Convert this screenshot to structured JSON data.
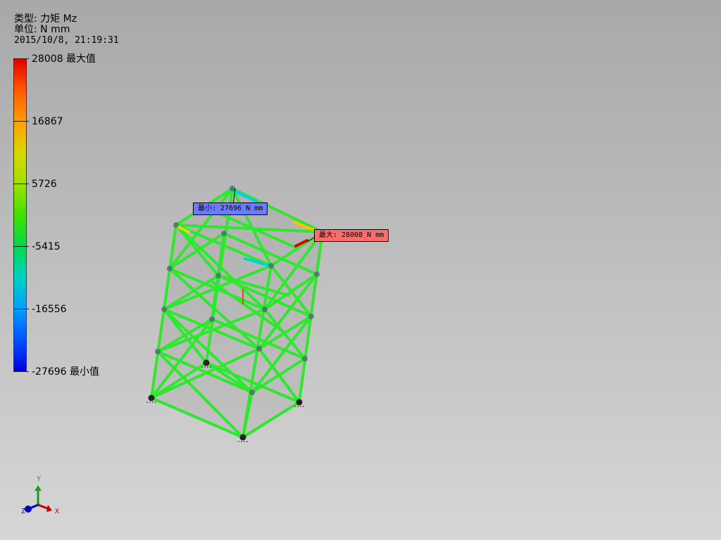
{
  "info": {
    "type_line": "类型: 力矩 Mz",
    "unit_line": "单位: N mm",
    "timestamp": "2015/10/8, 21:19:31"
  },
  "legend": {
    "ticks": [
      {
        "value": "28008",
        "suffix": "最大值"
      },
      {
        "value": "16867",
        "suffix": ""
      },
      {
        "value": "5726",
        "suffix": ""
      },
      {
        "value": "-5415",
        "suffix": ""
      },
      {
        "value": "-16556",
        "suffix": ""
      },
      {
        "value": "-27696",
        "suffix": "最小值"
      }
    ]
  },
  "probes": {
    "min_label": "最小:  27696 N mm",
    "max_label": "最大: 28008 N mm"
  },
  "triad": {
    "x": "X",
    "y": "Y",
    "z": "Z"
  },
  "colors": {
    "member": "#2ee82e",
    "member_outline": "#1a9c1a",
    "max_marker": "#ff6b6b",
    "min_marker": "#6b7bff"
  }
}
